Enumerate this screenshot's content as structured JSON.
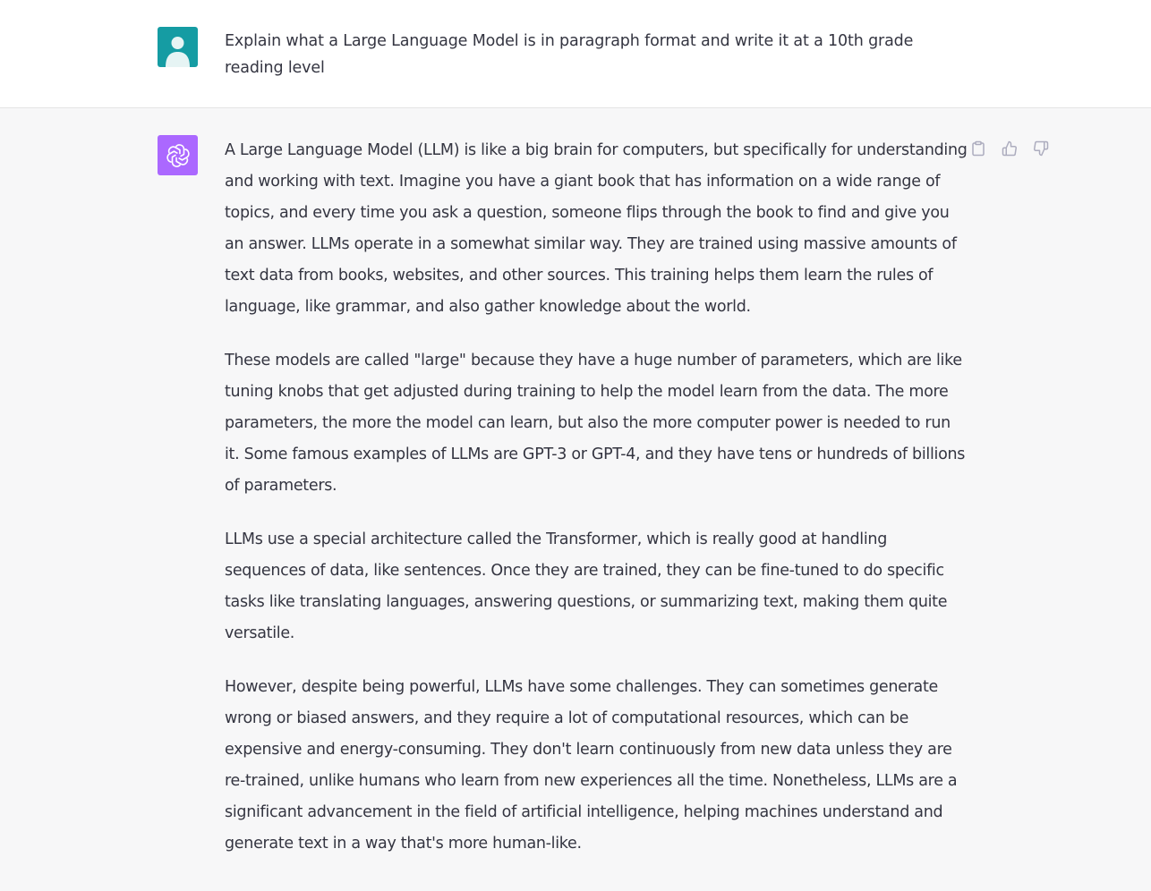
{
  "user_message": {
    "text": "Explain what a Large Language Model is in paragraph format and write it at a 10th grade reading level"
  },
  "assistant_message": {
    "paragraphs": [
      "A Large Language Model (LLM) is like a big brain for computers, but specifically for understanding and working with text. Imagine you have a giant book that has information on a wide range of topics, and every time you ask a question, someone flips through the book to find and give you an answer. LLMs operate in a somewhat similar way. They are trained using massive amounts of text data from books, websites, and other sources. This training helps them learn the rules of language, like grammar, and also gather knowledge about the world.",
      "These models are called \"large\" because they have a huge number of parameters, which are like tuning knobs that get adjusted during training to help the model learn from the data. The more parameters, the more the model can learn, but also the more computer power is needed to run it. Some famous examples of LLMs are GPT-3 or GPT-4, and they have tens or hundreds of billions of parameters.",
      "LLMs use a special architecture called the Transformer, which is really good at handling sequences of data, like sentences. Once they are trained, they can be fine-tuned to do specific tasks like translating languages, answering questions, or summarizing text, making them quite versatile.",
      "However, despite being powerful, LLMs have some challenges. They can sometimes generate wrong or biased answers, and they require a lot of computational resources, which can be expensive and energy-consuming. They don't learn continuously from new data unless they are re-trained, unlike humans who learn from new experiences all the time. Nonetheless, LLMs are a significant advancement in the field of artificial intelligence, helping machines understand and generate text in a way that's more human-like."
    ]
  },
  "icons": {
    "user_avatar": "user-icon",
    "assistant_avatar": "openai-logo-icon",
    "copy": "clipboard-icon",
    "thumbs_up": "thumbs-up-icon",
    "thumbs_down": "thumbs-down-icon"
  },
  "colors": {
    "user_avatar_bg": "#159ca3",
    "assistant_avatar_bg": "#ab68ff",
    "assistant_row_bg": "#f7f7f8",
    "text": "#343541",
    "icon": "#acacbe"
  }
}
